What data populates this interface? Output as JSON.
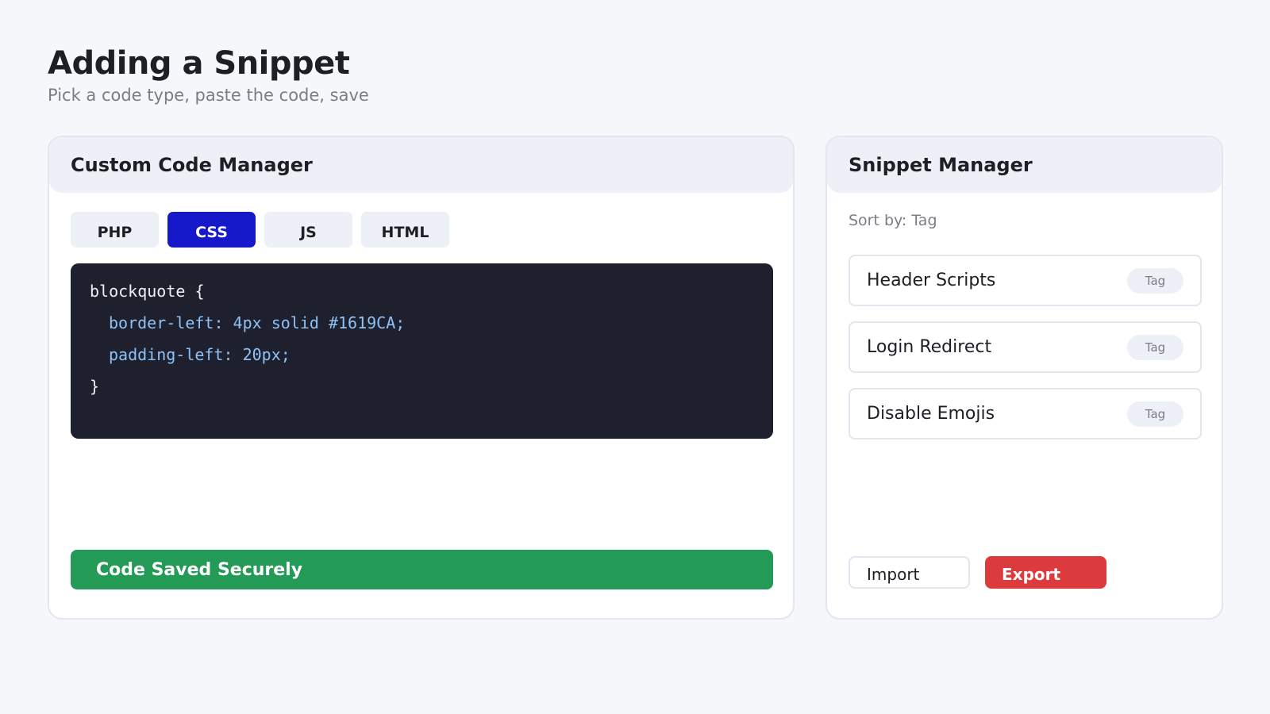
{
  "page": {
    "title": "Adding a Snippet",
    "subtitle": "Pick a code type, paste the code, save"
  },
  "code_manager": {
    "title": "Custom Code Manager",
    "tabs": [
      {
        "label": "PHP",
        "active": false
      },
      {
        "label": "CSS",
        "active": true
      },
      {
        "label": "JS",
        "active": false
      },
      {
        "label": "HTML",
        "active": false
      }
    ],
    "code_lines": [
      "blockquote {",
      "border-left: 4px solid #1619CA;",
      "padding-left: 20px;",
      "}"
    ],
    "status": "Code Saved Securely"
  },
  "snippet_manager": {
    "title": "Snippet Manager",
    "sort_label": "Sort by: Tag",
    "snippets": [
      {
        "name": "Header Scripts",
        "tag": "Tag"
      },
      {
        "name": "Login Redirect",
        "tag": "Tag"
      },
      {
        "name": "Disable Emojis",
        "tag": "Tag"
      }
    ],
    "import_label": "Import",
    "export_label": "Export"
  },
  "colors": {
    "accent": "#1619CA",
    "success": "#239A55",
    "danger": "#DC3B3E",
    "code_bg": "#1E202E"
  }
}
